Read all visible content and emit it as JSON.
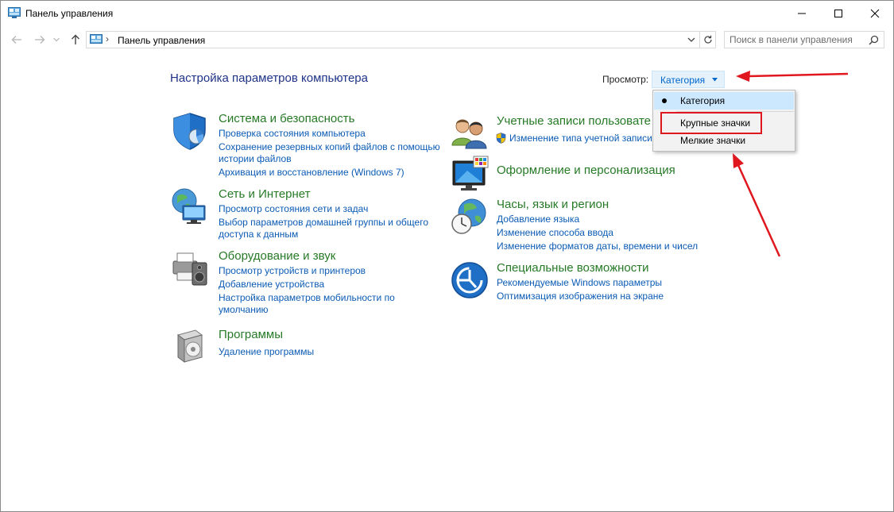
{
  "window": {
    "title": "Панель управления",
    "minimize_icon": "minimize-icon",
    "maximize_icon": "maximize-icon",
    "close_icon": "close-icon"
  },
  "navigation": {
    "address": "Панель управления",
    "search_placeholder": "Поиск в панели управления"
  },
  "content": {
    "heading": "Настройка параметров компьютера",
    "view_label": "Просмотр:",
    "view_value": "Категория"
  },
  "view_menu": {
    "options": [
      "Категория",
      "Крупные значки",
      "Мелкие значки"
    ],
    "selected": "Категория"
  },
  "categories": [
    {
      "title": "Система и безопасность",
      "icon": "shield-icon",
      "links": [
        "Проверка состояния компьютера",
        "Сохранение резервных копий файлов с помощью",
        "истории файлов",
        "Архивация и восстановление (Windows 7)"
      ]
    },
    {
      "title": "Сеть и Интернет",
      "icon": "network-globe-icon",
      "links": [
        "Просмотр состояния сети и задач",
        "Выбор параметров домашней группы и общего",
        "доступа к данным"
      ]
    },
    {
      "title": "Оборудование и звук",
      "icon": "printer-speaker-icon",
      "links": [
        "Просмотр устройств и принтеров",
        "Добавление устройства",
        "Настройка параметров мобильности по",
        "умолчанию"
      ]
    },
    {
      "title": "Программы",
      "icon": "programs-box-icon",
      "links": [
        "Удаление программы"
      ]
    },
    {
      "title": "Учетные записи пользовате",
      "icon": "users-icon",
      "links": [
        "Изменение типа учетной записи"
      ]
    },
    {
      "title": "Оформление и персонализация",
      "icon": "monitor-palette-icon",
      "links": []
    },
    {
      "title": "Часы, язык и регион",
      "icon": "clock-globe-icon",
      "links": [
        "Добавление языка",
        "Изменение способа ввода",
        "Изменение форматов даты, времени и чисел"
      ]
    },
    {
      "title": "Специальные возможности",
      "icon": "accessibility-icon",
      "links": [
        "Рекомендуемые Windows параметры",
        "Оптимизация изображения на экране"
      ]
    }
  ],
  "colors": {
    "category_title": "#267a26",
    "link": "#0b5bb5",
    "heading": "#1e3287",
    "annotation": "#e0171f",
    "menu_selected": "#cce8ff"
  }
}
